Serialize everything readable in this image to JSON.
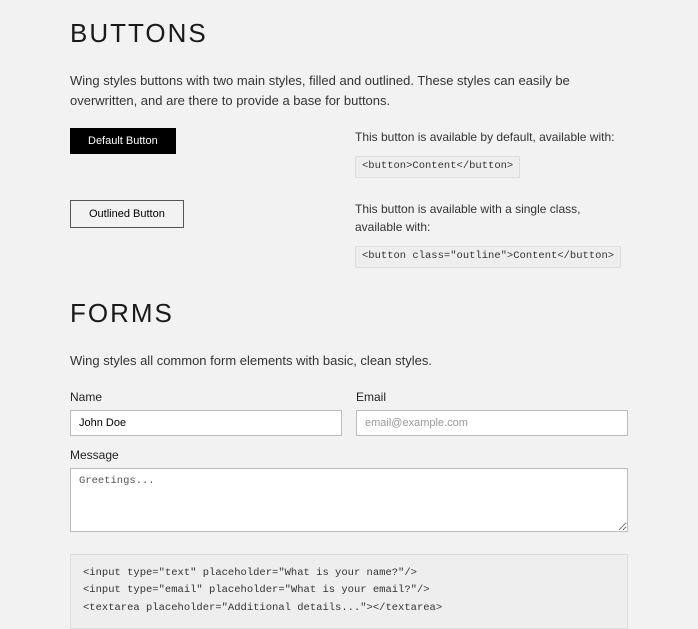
{
  "buttons": {
    "heading": "BUTTONS",
    "description": "Wing styles buttons with two main styles, filled and outlined. These styles can easily be overwritten, and are there to provide a base for buttons.",
    "default_button": {
      "label": "Default Button",
      "desc": "This button is available by default, available with:",
      "code": "<button>Content</button>"
    },
    "outlined_button": {
      "label": "Outlined Button",
      "desc": "This button is available with a single class, available with:",
      "code": "<button class=\"outline\">Content</button>"
    }
  },
  "forms": {
    "heading": "FORMS",
    "description": "Wing styles all common form elements with basic, clean styles.",
    "name": {
      "label": "Name",
      "value": "John Doe"
    },
    "email": {
      "label": "Email",
      "placeholder": "email@example.com"
    },
    "message": {
      "label": "Message",
      "value": "Greetings..."
    },
    "code_block": "<input type=\"text\" placeholder=\"What is your name?\"/>\n<input type=\"email\" placeholder=\"What is your email?\"/>\n<textarea placeholder=\"Additional details...\"></textarea>"
  }
}
